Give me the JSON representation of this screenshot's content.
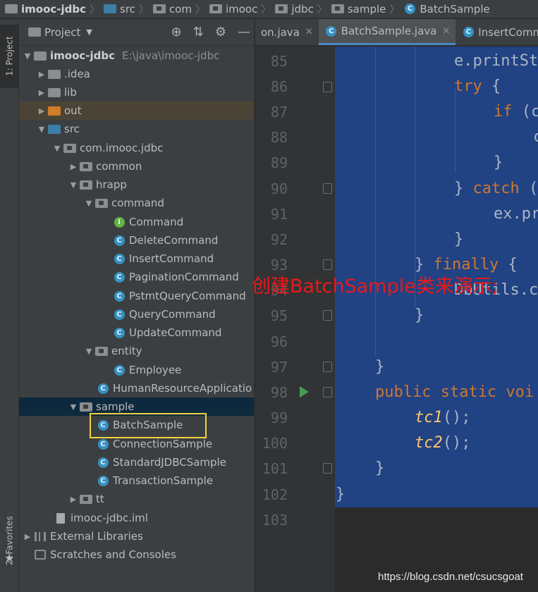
{
  "breadcrumb": [
    "imooc-jdbc",
    "src",
    "com",
    "imooc",
    "jdbc",
    "sample",
    "BatchSample"
  ],
  "tool_strip": {
    "project_tab": "1: Project",
    "favorites_tab": "2: Favorites",
    "structure_tab": "ure"
  },
  "project_panel": {
    "title": "Project",
    "root_name": "imooc-jdbc",
    "root_path": "E:\\java\\imooc-jdbc",
    "idea": ".idea",
    "lib": "lib",
    "out": "out",
    "src": "src",
    "pkg": "com.imooc.jdbc",
    "common": "common",
    "hrapp": "hrapp",
    "command": "command",
    "command_classes": [
      "Command",
      "DeleteCommand",
      "InsertCommand",
      "PaginationCommand",
      "PstmtQueryCommand",
      "QueryCommand",
      "UpdateCommand"
    ],
    "entity": "entity",
    "employee": "Employee",
    "hr_app": "HumanResourceApplicatio",
    "sample": "sample",
    "sample_classes": [
      "BatchSample",
      "ConnectionSample",
      "StandardJDBCSample",
      "TransactionSample"
    ],
    "tt": "tt",
    "iml": "imooc-jdbc.iml",
    "external_libraries": "External Libraries",
    "scratches": "Scratches and Consoles"
  },
  "editor_tabs": [
    "on.java",
    "BatchSample.java",
    "InsertComman"
  ],
  "line_numbers": [
    "85",
    "86",
    "87",
    "88",
    "89",
    "90",
    "91",
    "92",
    "93",
    "94",
    "95",
    "96",
    "97",
    "98",
    "99",
    "100",
    "101",
    "102",
    "103"
  ],
  "code": {
    "l85": "e.printSt",
    "l86_kw": "try",
    "l86_rest": " {",
    "l87_kw": "if",
    "l87_rest": " (c",
    "l88": "c",
    "l89": "}",
    "l90_a": "} ",
    "l90_kw": "catch",
    "l90_rest": " (",
    "l91": "ex.pr",
    "l92": "}",
    "l93_a": "} ",
    "l93_kw": "finally",
    "l93_rest": " {",
    "l94": "DbUtils.c",
    "l95": "}",
    "l97": "}",
    "l98_kw": "public static voi",
    "l99_fn": "tc1",
    "l99_rest": "();",
    "l100_fn": "tc2",
    "l100_rest": "();",
    "l101": "}",
    "l102": "}"
  },
  "annotation": "创建BatchSample类来演示;",
  "watermark": "https://blog.csdn.net/csucsgoat",
  "colors": {
    "selection": "#214283",
    "keyword": "#cc7832",
    "annotation": "#e8191b",
    "highlight_box": "#f4d33c"
  }
}
